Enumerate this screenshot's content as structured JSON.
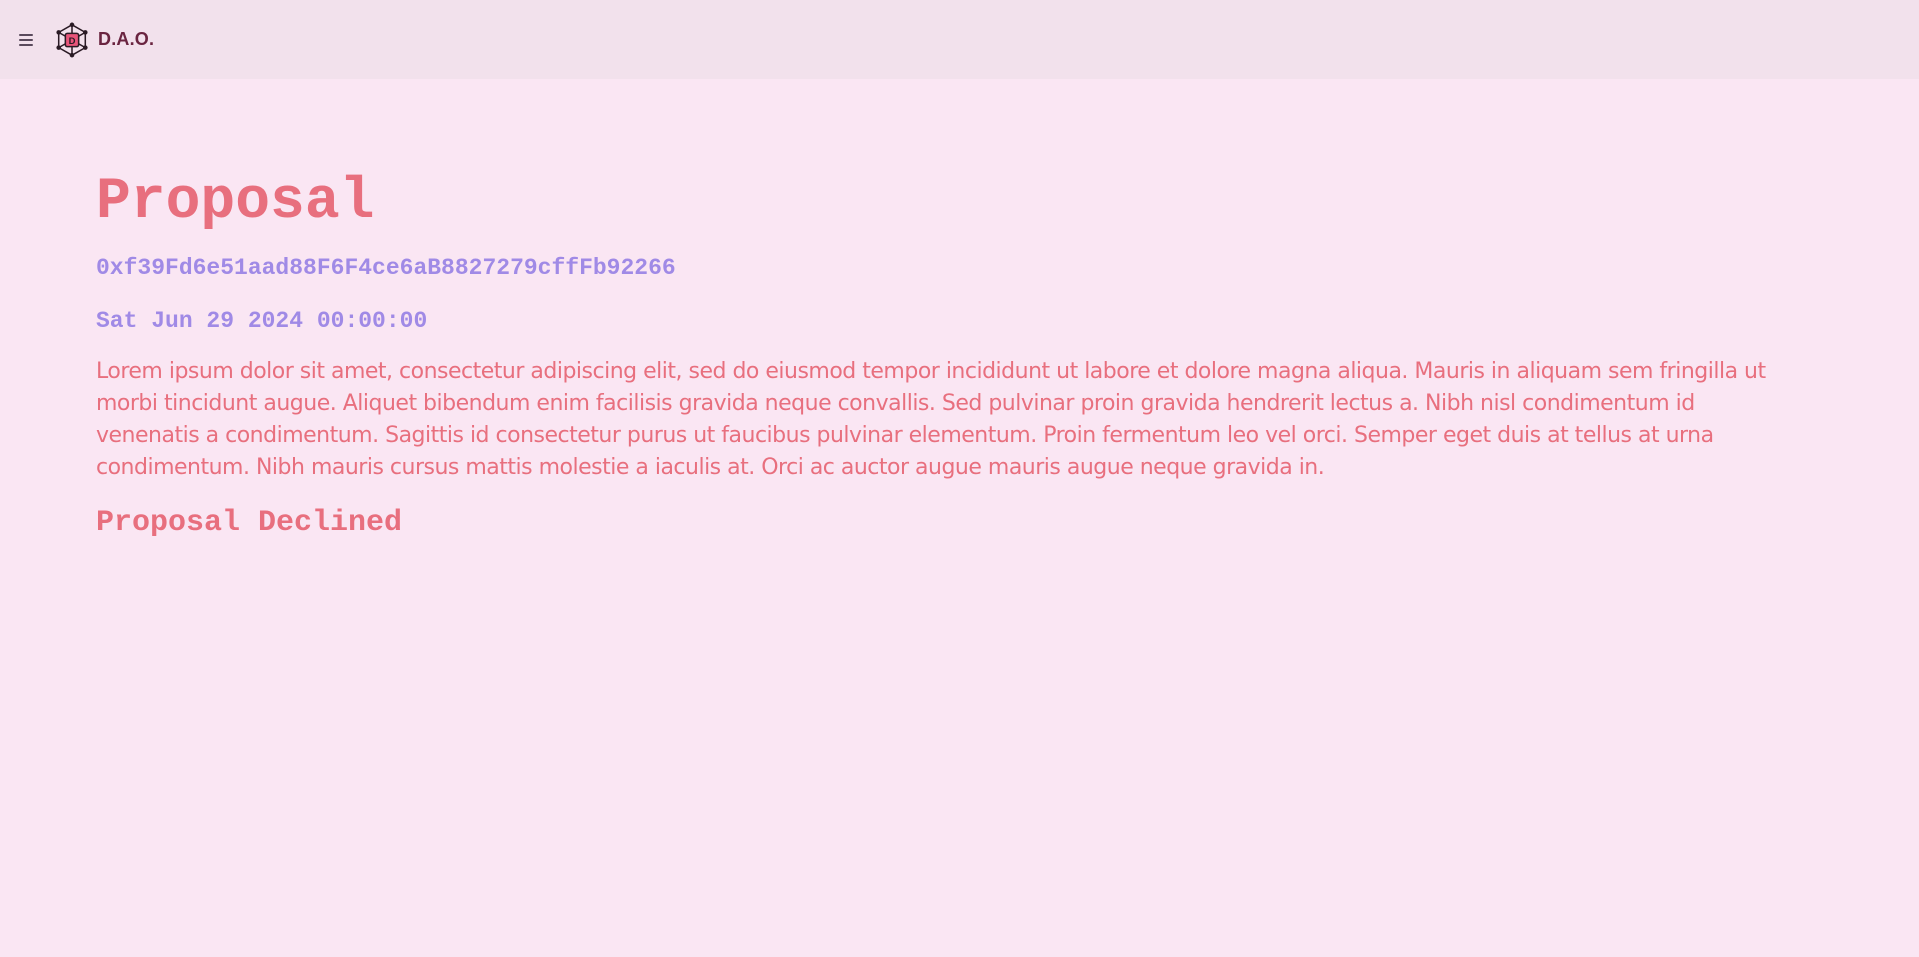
{
  "header": {
    "brand": "D.A.O.",
    "menu_icon": "hamburger-menu-icon",
    "logo_icon": "dao-network-logo-icon",
    "logo_letter": "D"
  },
  "proposal": {
    "title": "Proposal",
    "address": "0xf39Fd6e51aad88F6F4ce6aB8827279cffFb92266",
    "date": "Sat Jun 29 2024 00:00:00",
    "description": "Lorem ipsum dolor sit amet, consectetur adipiscing elit, sed do eiusmod tempor incididunt ut labore et dolore magna aliqua. Mauris in aliquam sem fringilla ut morbi tincidunt augue. Aliquet bibendum enim facilisis gravida neque convallis. Sed pulvinar proin gravida hendrerit lectus a. Nibh nisl condimentum id venenatis a condimentum. Sagittis id consectetur purus ut faucibus pulvinar elementum. Proin fermentum leo vel orci. Semper eget duis at tellus at urna condimentum. Nibh mauris cursus mattis molestie a iaculis at. Orci ac auctor augue mauris augue neque gravida in.",
    "status": "Proposal Declined"
  },
  "colors": {
    "background": "#fae6f3",
    "header_background": "#f2e1ec",
    "accent_pink": "#e86f7e",
    "accent_purple": "#a08ae6",
    "brand_text": "#6a2440"
  }
}
